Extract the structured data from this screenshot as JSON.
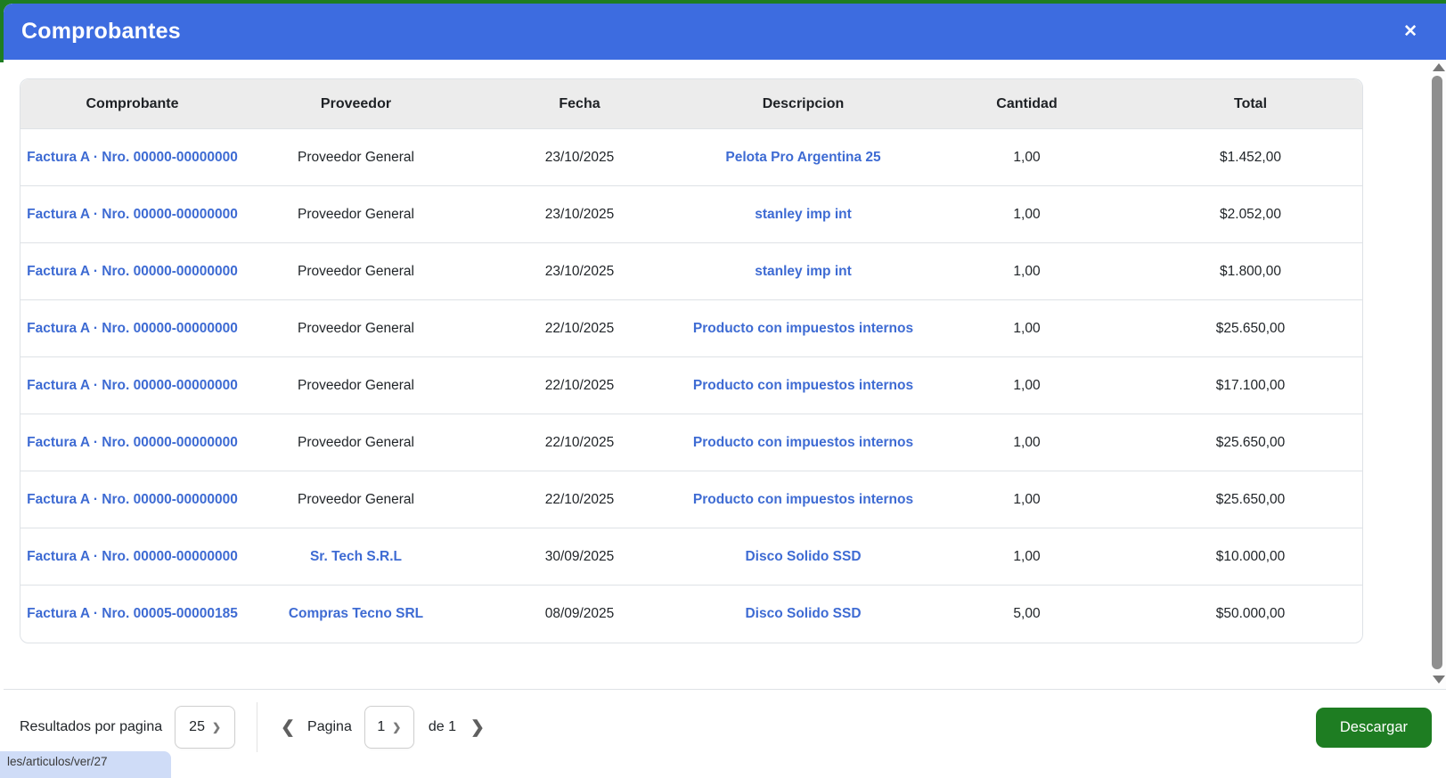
{
  "modal": {
    "title": "Comprobantes",
    "close_icon": "✕"
  },
  "colors": {
    "header_blue": "#3d6ce0",
    "link_blue": "#3e6bd3",
    "action_green": "#1e7d22",
    "table_border": "#dee2e6",
    "header_row_bg": "#ececec"
  },
  "table": {
    "columns": [
      "Comprobante",
      "Proveedor",
      "Fecha",
      "Descripcion",
      "Cantidad",
      "Total"
    ],
    "rows": [
      {
        "comprobante": "Factura A · Nro. 00000-00000000",
        "proveedor": "Proveedor General",
        "proveedor_is_link": false,
        "fecha": "23/10/2025",
        "descripcion": "Pelota Pro Argentina 25",
        "cantidad": "1,00",
        "total": "$1.452,00"
      },
      {
        "comprobante": "Factura A · Nro. 00000-00000000",
        "proveedor": "Proveedor General",
        "proveedor_is_link": false,
        "fecha": "23/10/2025",
        "descripcion": "stanley imp int",
        "cantidad": "1,00",
        "total": "$2.052,00"
      },
      {
        "comprobante": "Factura A · Nro. 00000-00000000",
        "proveedor": "Proveedor General",
        "proveedor_is_link": false,
        "fecha": "23/10/2025",
        "descripcion": "stanley imp int",
        "cantidad": "1,00",
        "total": "$1.800,00"
      },
      {
        "comprobante": "Factura A · Nro. 00000-00000000",
        "proveedor": "Proveedor General",
        "proveedor_is_link": false,
        "fecha": "22/10/2025",
        "descripcion": "Producto con impuestos internos",
        "cantidad": "1,00",
        "total": "$25.650,00"
      },
      {
        "comprobante": "Factura A · Nro. 00000-00000000",
        "proveedor": "Proveedor General",
        "proveedor_is_link": false,
        "fecha": "22/10/2025",
        "descripcion": "Producto con impuestos internos",
        "cantidad": "1,00",
        "total": "$17.100,00"
      },
      {
        "comprobante": "Factura A · Nro. 00000-00000000",
        "proveedor": "Proveedor General",
        "proveedor_is_link": false,
        "fecha": "22/10/2025",
        "descripcion": "Producto con impuestos internos",
        "cantidad": "1,00",
        "total": "$25.650,00"
      },
      {
        "comprobante": "Factura A · Nro. 00000-00000000",
        "proveedor": "Proveedor General",
        "proveedor_is_link": false,
        "fecha": "22/10/2025",
        "descripcion": "Producto con impuestos internos",
        "cantidad": "1,00",
        "total": "$25.650,00"
      },
      {
        "comprobante": "Factura A · Nro. 00000-00000000",
        "proveedor": "Sr. Tech S.R.L",
        "proveedor_is_link": true,
        "fecha": "30/09/2025",
        "descripcion": "Disco Solido SSD",
        "cantidad": "1,00",
        "total": "$10.000,00"
      },
      {
        "comprobante": "Factura A · Nro. 00005-00000185",
        "proveedor": "Compras Tecno SRL",
        "proveedor_is_link": true,
        "fecha": "08/09/2025",
        "descripcion": "Disco Solido SSD",
        "cantidad": "5,00",
        "total": "$50.000,00"
      }
    ]
  },
  "pagination": {
    "results_label": "Resultados por pagina",
    "page_size_value": "25",
    "page_word": "Pagina",
    "current_page": "1",
    "of_label": "de 1",
    "select_chevron_icon": "❯",
    "prev_icon": "❮",
    "next_icon": "❯"
  },
  "actions": {
    "download_label": "Descargar"
  },
  "status_bar": {
    "link_text": "les/articulos/ver/27"
  }
}
